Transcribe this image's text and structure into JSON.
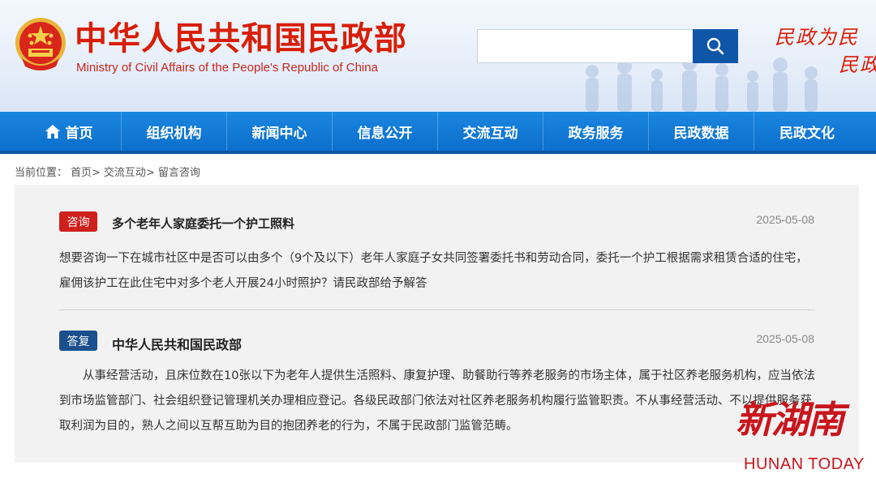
{
  "header": {
    "title": "中华人民共和国民政部",
    "subtitle": "Ministry of Civil Affairs of the People's Republic of China",
    "search_placeholder": "",
    "slogan_line1": "民政为民",
    "slogan_line2": "民政",
    "brand_color": "#d81e06"
  },
  "nav": {
    "items": [
      {
        "label": "首页",
        "icon": "home-icon"
      },
      {
        "label": "组织机构"
      },
      {
        "label": "新闻中心"
      },
      {
        "label": "信息公开"
      },
      {
        "label": "交流互动"
      },
      {
        "label": "政务服务"
      },
      {
        "label": "民政数据"
      },
      {
        "label": "民政文化"
      }
    ],
    "color": "#0c6fcc"
  },
  "breadcrumb": {
    "prefix": "当前位置：",
    "items": [
      "首页>",
      "交流互动>",
      "留言咨询"
    ]
  },
  "question": {
    "badge": "咨询",
    "title": "多个老年人家庭委托一个护工照料",
    "date": "2025-05-08",
    "body": "想要咨询一下在城市社区中是否可以由多个（9个及以下）老年人家庭子女共同签署委托书和劳动合同，委托一个护工根据需求租赁合适的住宅，雇佣该护工在此住宅中对多个老人开展24小时照护？请民政部给予解答",
    "badge_color": "#d0201c"
  },
  "answer": {
    "badge": "答复",
    "title": "中华人民共和国民政部",
    "date": "2025-05-08",
    "body": "从事经营活动，且床位数在10张以下为老年人提供生活照料、康复护理、助餐助行等养老服务的市场主体，属于社区养老服务机构，应当依法到市场监管部门、社会组织登记管理机关办理相应登记。各级民政部门依法对社区养老服务机构履行监管职责。不从事经营活动、不以提供服务获取利润为目的，熟人之间以互帮互助为目的抱团养老的行为，不属于民政部门监管范畴。",
    "badge_color": "#1b4f8e"
  },
  "watermark": {
    "cn": "新湖南",
    "en": "HUNAN TODAY"
  }
}
